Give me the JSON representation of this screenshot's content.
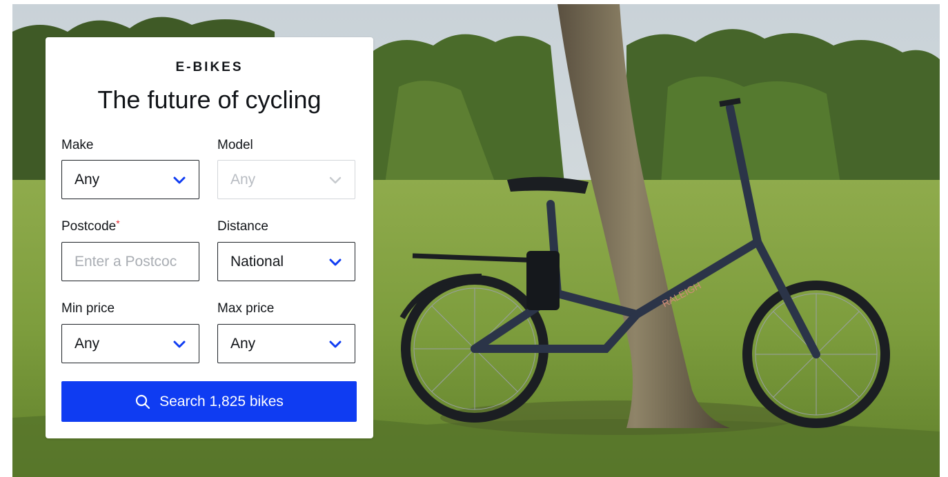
{
  "hero": {
    "image_subject": "Folding e-bike leaning against a tree in a sunny park",
    "bike_frame_text": "RALEIGH"
  },
  "search_card": {
    "eyebrow": "E-BIKES",
    "headline": "The future of cycling",
    "make": {
      "label": "Make",
      "value": "Any"
    },
    "model": {
      "label": "Model",
      "value": "Any",
      "disabled": true
    },
    "postcode": {
      "label": "Postcode",
      "required_marker": "*",
      "placeholder": "Enter a Postcoc"
    },
    "distance": {
      "label": "Distance",
      "value": "National"
    },
    "min_price": {
      "label": "Min price",
      "value": "Any"
    },
    "max_price": {
      "label": "Max price",
      "value": "Any"
    },
    "search_button": {
      "label": "Search 1,825 bikes",
      "icon": "search-icon"
    }
  },
  "colors": {
    "accent": "#0f3cf2",
    "chevron": "#0f3cf2",
    "required": "#e0262f",
    "text": "#111418"
  }
}
